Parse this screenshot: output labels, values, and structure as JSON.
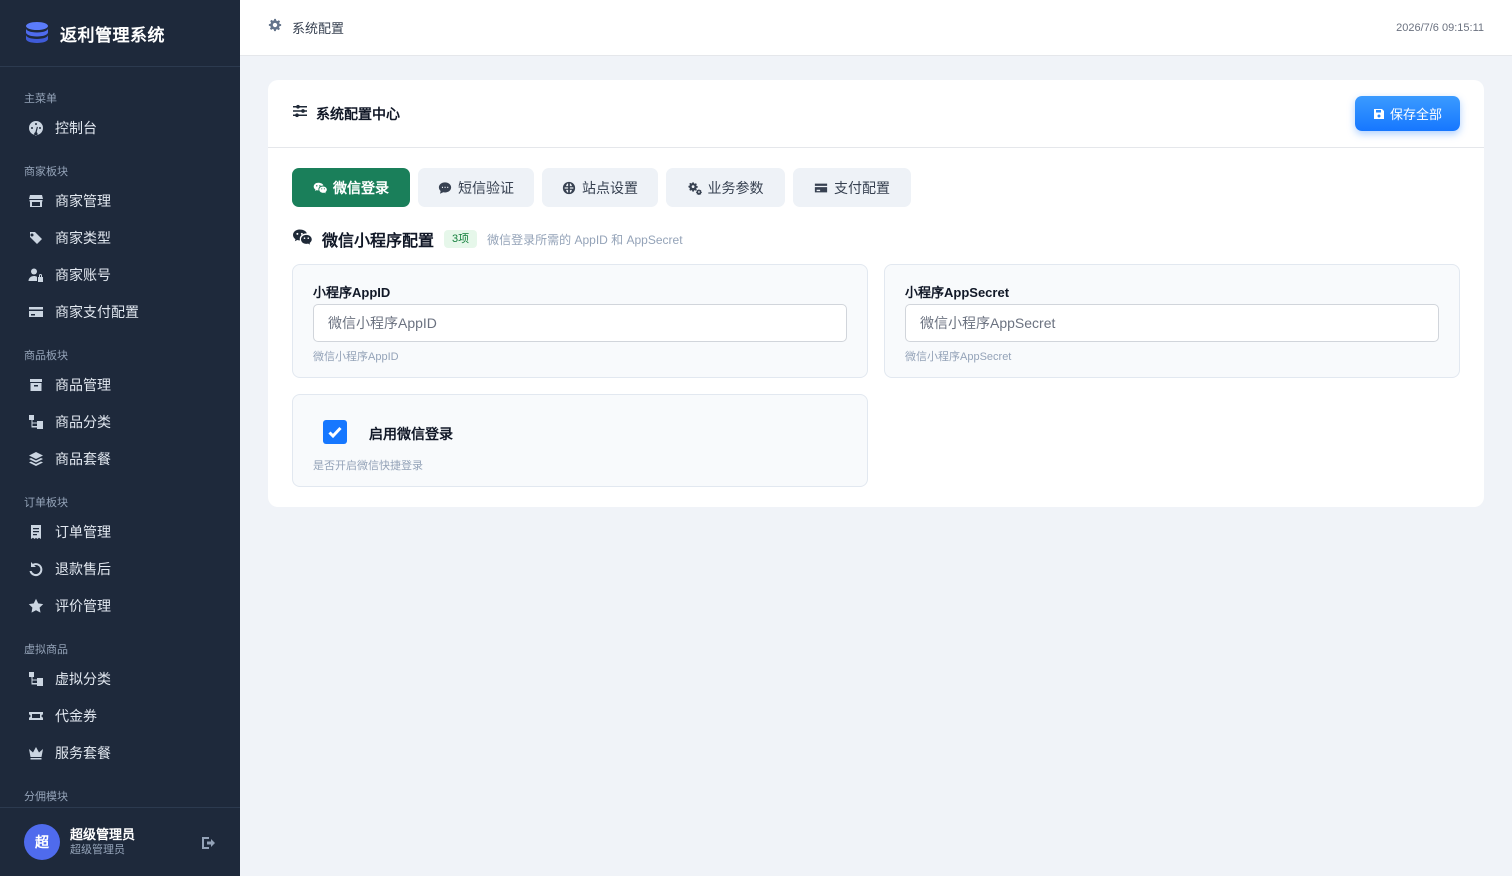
{
  "app": {
    "title": "返利管理系统",
    "logo_icon": "database-icon"
  },
  "sidebar": {
    "groups": [
      {
        "title": "主菜单",
        "items": [
          {
            "label": "控制台",
            "icon": "dashboard-icon"
          }
        ]
      },
      {
        "title": "商家板块",
        "items": [
          {
            "label": "商家管理",
            "icon": "store-icon"
          },
          {
            "label": "商家类型",
            "icon": "tags-icon"
          },
          {
            "label": "商家账号",
            "icon": "user-lock-icon"
          },
          {
            "label": "商家支付配置",
            "icon": "credit-card-icon"
          }
        ]
      },
      {
        "title": "商品板块",
        "items": [
          {
            "label": "商品管理",
            "icon": "box-icon"
          },
          {
            "label": "商品分类",
            "icon": "sitemap-icon"
          },
          {
            "label": "商品套餐",
            "icon": "layers-icon"
          }
        ]
      },
      {
        "title": "订单板块",
        "items": [
          {
            "label": "订单管理",
            "icon": "receipt-icon"
          },
          {
            "label": "退款售后",
            "icon": "undo-icon"
          },
          {
            "label": "评价管理",
            "icon": "star-icon"
          }
        ]
      },
      {
        "title": "虚拟商品",
        "items": [
          {
            "label": "虚拟分类",
            "icon": "sitemap-icon"
          },
          {
            "label": "代金券",
            "icon": "ticket-icon"
          },
          {
            "label": "服务套餐",
            "icon": "crown-icon"
          }
        ]
      },
      {
        "title": "分佣模块",
        "items": []
      }
    ]
  },
  "user": {
    "avatar_text": "超",
    "name": "超级管理员",
    "role": "超级管理员"
  },
  "header": {
    "breadcrumb": "系统配置",
    "time": "2026/7/6 09:15:11"
  },
  "card": {
    "title": "系统配置中心",
    "save_label": "保存全部"
  },
  "tabs": [
    {
      "label": "微信登录",
      "icon": "wechat-icon",
      "active": true
    },
    {
      "label": "短信验证",
      "icon": "sms-icon",
      "active": false
    },
    {
      "label": "站点设置",
      "icon": "globe-icon",
      "active": false
    },
    {
      "label": "业务参数",
      "icon": "cogs-icon",
      "active": false
    },
    {
      "label": "支付配置",
      "icon": "credit-card-icon",
      "active": false
    }
  ],
  "section": {
    "title": "微信小程序配置",
    "badge": "3项",
    "desc": "微信登录所需的 AppID 和 AppSecret"
  },
  "fields": {
    "appid": {
      "label": "小程序AppID",
      "placeholder": "微信小程序AppID",
      "value": "",
      "hint": "微信小程序AppID"
    },
    "appsecret": {
      "label": "小程序AppSecret",
      "placeholder": "微信小程序AppSecret",
      "value": "",
      "hint": "微信小程序AppSecret"
    },
    "enable": {
      "label": "启用微信登录",
      "checked": true,
      "hint": "是否开启微信快捷登录"
    }
  },
  "colors": {
    "sidebar_bg": "#1e293b",
    "active_tab": "#1a7f5a",
    "primary": "#1677ff",
    "page_bg": "#f0f3f8"
  }
}
